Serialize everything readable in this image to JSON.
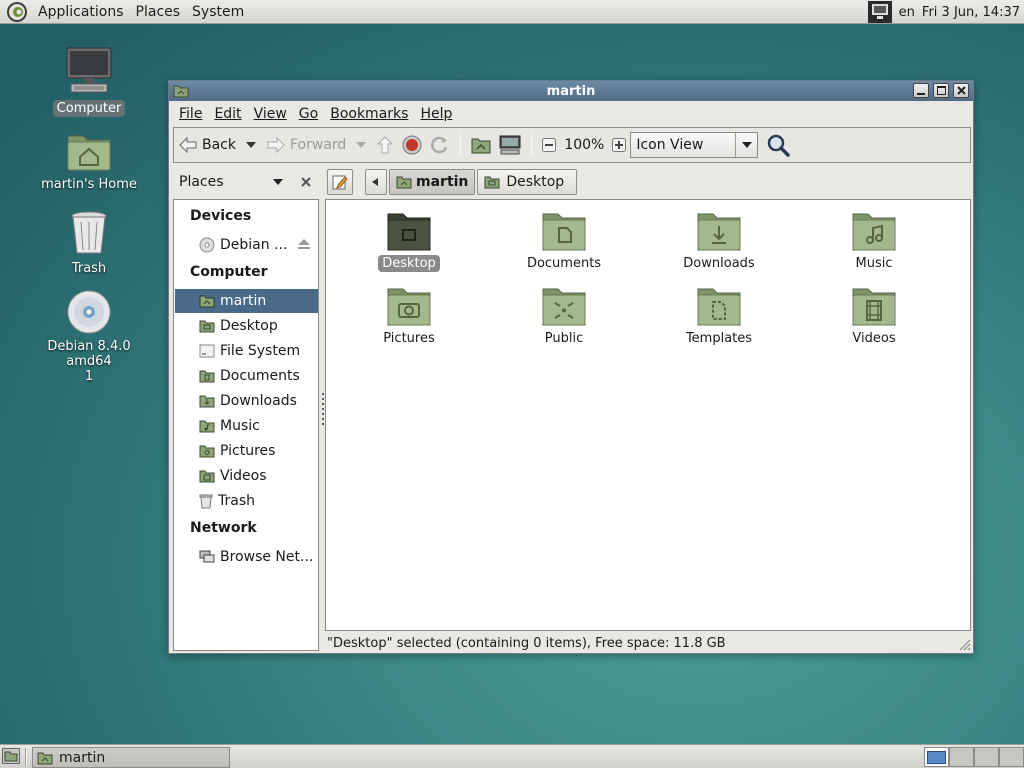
{
  "top_panel": {
    "menus": [
      "Applications",
      "Places",
      "System"
    ],
    "keyboard_layout": "en",
    "clock": "Fri  3 Jun, 14:37"
  },
  "desktop": {
    "icons": [
      {
        "label": "Computer",
        "icon": "computer-icon",
        "selected": true
      },
      {
        "label": "martin's Home",
        "icon": "home-folder-icon",
        "selected": false
      },
      {
        "label": "Trash",
        "icon": "trash-icon",
        "selected": false
      },
      {
        "label": "Debian 8.4.0 amd64\n1",
        "icon": "optical-disc-icon",
        "selected": false
      }
    ]
  },
  "window": {
    "title": "martin",
    "menu": [
      "File",
      "Edit",
      "View",
      "Go",
      "Bookmarks",
      "Help"
    ],
    "toolbar": {
      "back_label": "Back",
      "forward_label": "Forward",
      "zoom_level": "100%",
      "view_mode": "Icon View"
    },
    "sidebar": {
      "header": "Places",
      "sections": [
        {
          "title": "Devices",
          "items": [
            {
              "label": "Debian ...",
              "icon": "disc-icon",
              "eject": true
            }
          ]
        },
        {
          "title": "Computer",
          "items": [
            {
              "label": "martin",
              "icon": "home-folder-icon",
              "selected": true
            },
            {
              "label": "Desktop",
              "icon": "desktop-folder-icon"
            },
            {
              "label": "File System",
              "icon": "drive-icon"
            },
            {
              "label": "Documents",
              "icon": "documents-folder-icon"
            },
            {
              "label": "Downloads",
              "icon": "downloads-folder-icon"
            },
            {
              "label": "Music",
              "icon": "music-folder-icon"
            },
            {
              "label": "Pictures",
              "icon": "pictures-folder-icon"
            },
            {
              "label": "Videos",
              "icon": "videos-folder-icon"
            },
            {
              "label": "Trash",
              "icon": "trash-icon"
            }
          ]
        },
        {
          "title": "Network",
          "items": [
            {
              "label": "Browse Net...",
              "icon": "network-icon"
            }
          ]
        }
      ]
    },
    "path": [
      "martin",
      "Desktop"
    ],
    "files": [
      {
        "label": "Desktop",
        "icon": "desktop-folder-icon",
        "selected": true
      },
      {
        "label": "Documents",
        "icon": "documents-folder-icon"
      },
      {
        "label": "Downloads",
        "icon": "downloads-folder-icon"
      },
      {
        "label": "Music",
        "icon": "music-folder-icon"
      },
      {
        "label": "Pictures",
        "icon": "pictures-folder-icon"
      },
      {
        "label": "Public",
        "icon": "public-folder-icon"
      },
      {
        "label": "Templates",
        "icon": "templates-folder-icon"
      },
      {
        "label": "Videos",
        "icon": "videos-folder-icon"
      }
    ],
    "status": "\"Desktop\" selected (containing 0 items), Free space: 11.8 GB"
  },
  "bottom_panel": {
    "task_label": "martin",
    "workspace_count": 4,
    "active_workspace": 1
  },
  "colors": {
    "selection": "#4a6a8a",
    "folder": "#9caf86",
    "titlebar": "#5a7794"
  }
}
